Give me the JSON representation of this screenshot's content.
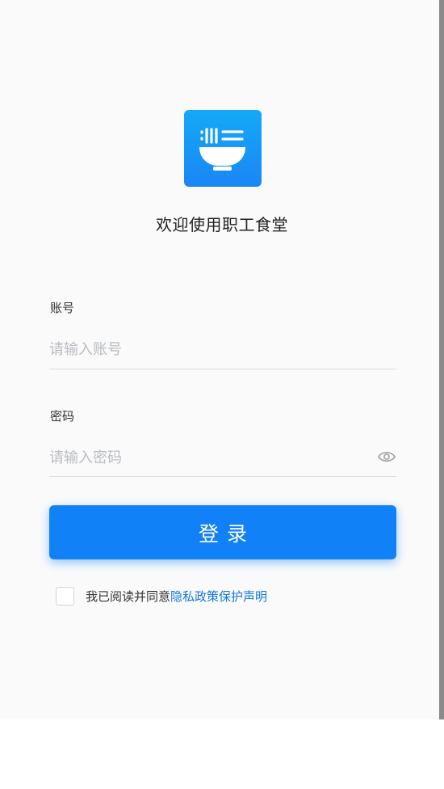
{
  "app": {
    "logo_icon": "noodle-bowl-icon",
    "brand_color": "#1081f6"
  },
  "welcome_text": "欢迎使用职工食堂",
  "account": {
    "label": "账号",
    "placeholder": "请输入账号",
    "value": ""
  },
  "password": {
    "label": "密码",
    "placeholder": "请输入密码",
    "value": "",
    "toggle_icon": "eye-icon"
  },
  "login_button": {
    "label": "登录"
  },
  "agreement": {
    "checked": false,
    "text": "我已阅读并同意",
    "link": "隐私政策保护声明",
    "link_color": "#1477e0"
  }
}
